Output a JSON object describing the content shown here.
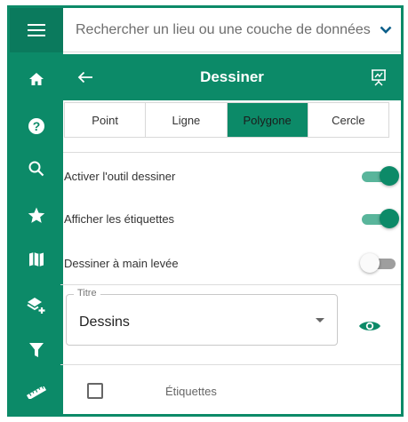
{
  "search": {
    "placeholder": "Rechercher un lieu ou une couche de données"
  },
  "sidebar": {
    "items": [
      {
        "icon": "menu-icon"
      },
      {
        "icon": "home-icon"
      },
      {
        "icon": "help-icon"
      },
      {
        "icon": "search-icon"
      },
      {
        "icon": "star-icon"
      },
      {
        "icon": "map-icon"
      },
      {
        "icon": "layers-add-icon"
      },
      {
        "icon": "filter-icon"
      },
      {
        "icon": "ruler-icon"
      }
    ]
  },
  "header": {
    "title": "Dessiner"
  },
  "tabs": [
    {
      "label": "Point",
      "active": false
    },
    {
      "label": "Ligne",
      "active": false
    },
    {
      "label": "Polygone",
      "active": true
    },
    {
      "label": "Cercle",
      "active": false
    }
  ],
  "settings": [
    {
      "label": "Activer l'outil dessiner",
      "on": true
    },
    {
      "label": "Afficher les étiquettes",
      "on": true
    },
    {
      "label": "Dessiner à main levée",
      "on": false
    }
  ],
  "select": {
    "legend": "Titre",
    "value": "Dessins"
  },
  "labels_row": {
    "label": "Étiquettes",
    "checked": false
  },
  "colors": {
    "primary": "#0c8a68",
    "toggle_track_on": "#59b59b",
    "toggle_track_off": "#9e9e9e"
  }
}
